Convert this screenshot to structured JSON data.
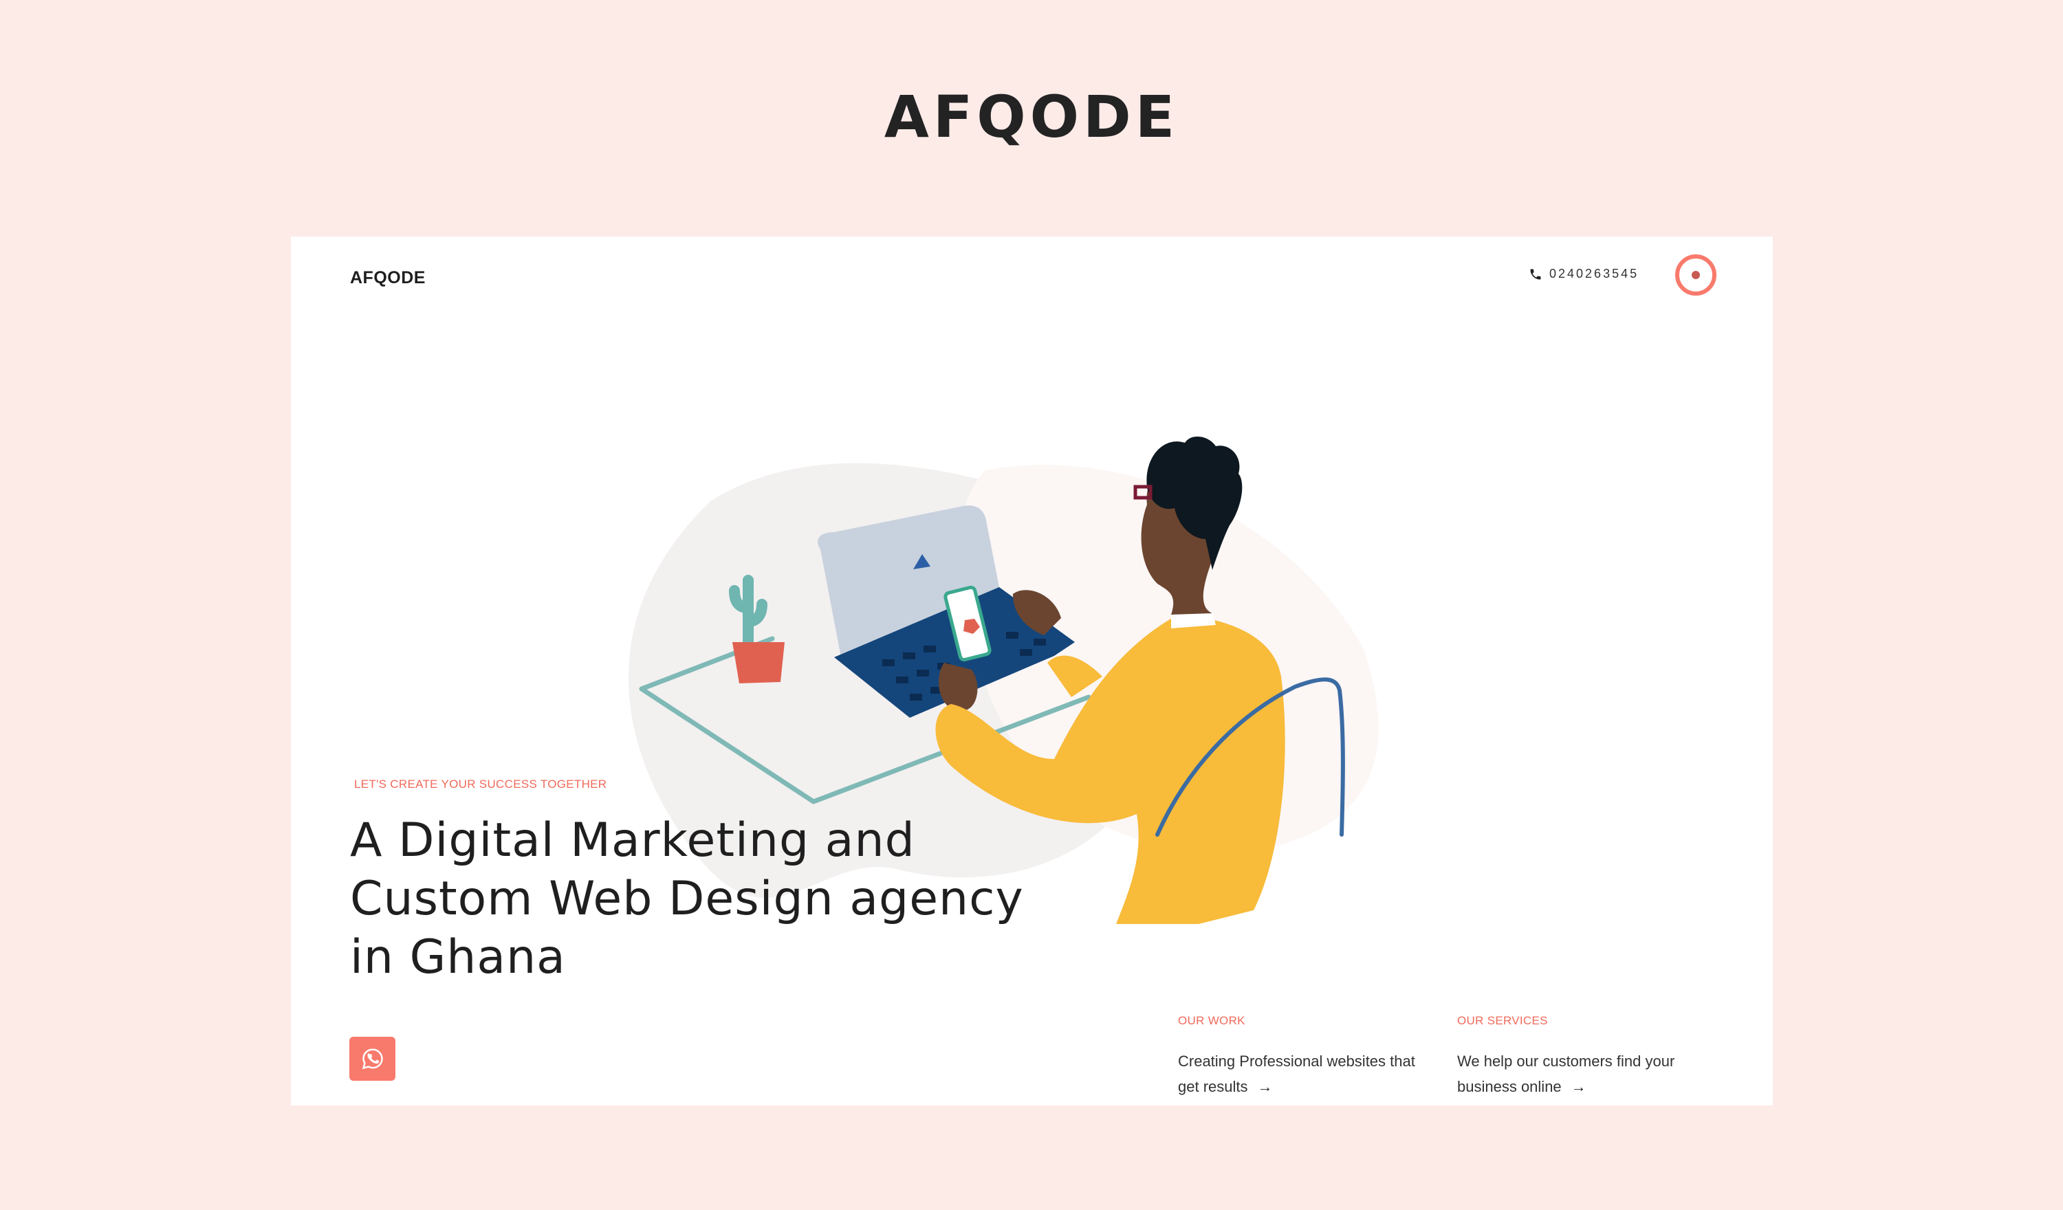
{
  "showcase": {
    "title": "AFQODE"
  },
  "header": {
    "logo": "AFQODE",
    "phone": "0240263545",
    "icons": {
      "phone": "phone-icon",
      "menu": "target-menu-icon"
    }
  },
  "hero": {
    "tagline": "LET'S CREATE YOUR SUCCESS TOGETHER",
    "headline_lines": [
      "A Digital Marketing and",
      "Custom Web Design agency",
      "in Ghana"
    ]
  },
  "whatsapp": {
    "icon": "whatsapp-icon"
  },
  "features": [
    {
      "eyebrow": "OUR WORK",
      "text_lines": [
        "Creating Professional websites that",
        "get results"
      ],
      "arrow": "→"
    },
    {
      "eyebrow": "OUR SERVICES",
      "text_lines": [
        "We help our customers find your",
        "business online"
      ],
      "arrow": "→"
    }
  ],
  "colors": {
    "page_bg": "#fdebe8",
    "accent": "#f87a6c",
    "text": "#1f1f1f"
  }
}
